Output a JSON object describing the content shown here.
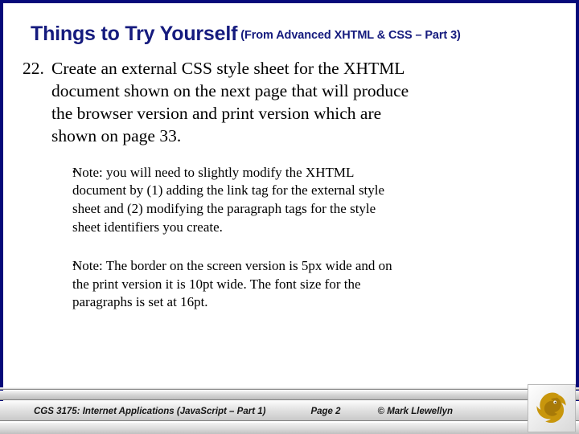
{
  "slide": {
    "title": {
      "main": "Things to Try Yourself",
      "sub": "(From Advanced XHTML & CSS – Part 3)"
    },
    "numbered_item": {
      "marker": "22.",
      "lines": [
        "Create an external CSS style sheet for the XHTML",
        "document shown on the next page that will produce",
        "the browser version and print version which are",
        "shown on page 33."
      ]
    },
    "sub_items": [
      {
        "marker": "•",
        "lines": [
          "Note: you will need to slightly modify the XHTML",
          "document by (1) adding the link tag for the external style",
          "sheet and (2) modifying the paragraph tags for the style",
          "sheet identifiers you create."
        ]
      },
      {
        "marker": "•",
        "lines": [
          "Note:  The border on the screen version is 5px wide and on",
          "the print version it is 10pt wide.  The font size for the",
          "paragraphs is set at 16pt."
        ]
      }
    ],
    "footer": {
      "course": "CGS 3175: Internet Applications (JavaScript – Part 1)",
      "page": "Page 2",
      "copyright": "© Mark Llewellyn"
    },
    "colors": {
      "title": "#151B7E",
      "frame": "#060A7A",
      "logo": "#C8960C",
      "body_text": "#000000"
    },
    "logo": {
      "name": "pegasus-logo"
    }
  }
}
